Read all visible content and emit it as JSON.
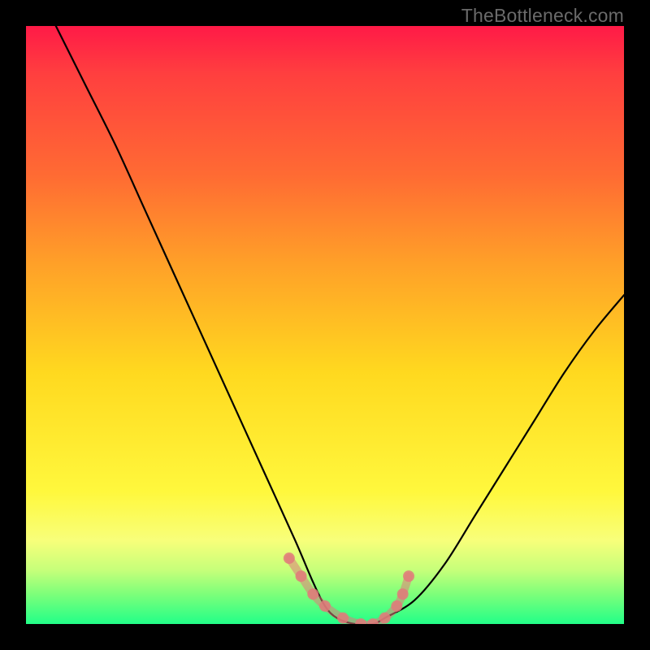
{
  "watermark": "TheBottleneck.com",
  "chart_data": {
    "type": "line",
    "title": "",
    "xlabel": "",
    "ylabel": "",
    "xlim": [
      0,
      100
    ],
    "ylim": [
      0,
      100
    ],
    "background_gradient_stops": [
      {
        "pos": 0,
        "color": "#ff1a47"
      },
      {
        "pos": 8,
        "color": "#ff3f3f"
      },
      {
        "pos": 25,
        "color": "#ff6b33"
      },
      {
        "pos": 40,
        "color": "#ffa128"
      },
      {
        "pos": 58,
        "color": "#ffd91f"
      },
      {
        "pos": 78,
        "color": "#fff83d"
      },
      {
        "pos": 86,
        "color": "#f8ff7a"
      },
      {
        "pos": 91,
        "color": "#c6ff7a"
      },
      {
        "pos": 95,
        "color": "#7dff7a"
      },
      {
        "pos": 100,
        "color": "#22ff88"
      }
    ],
    "series": [
      {
        "name": "bottleneck-curve",
        "x": [
          5,
          10,
          15,
          20,
          25,
          30,
          35,
          40,
          45,
          48,
          50,
          52,
          55,
          58,
          60,
          65,
          70,
          75,
          80,
          85,
          90,
          95,
          100
        ],
        "values": [
          100,
          90,
          80,
          69,
          58,
          47,
          36,
          25,
          14,
          7,
          3,
          1,
          0,
          0,
          1,
          4,
          10,
          18,
          26,
          34,
          42,
          49,
          55
        ]
      }
    ],
    "markers": {
      "name": "highlight-region",
      "color": "#e07a7a",
      "x": [
        44,
        46,
        48,
        50,
        53,
        56,
        58,
        60,
        62,
        63,
        64
      ],
      "values": [
        11,
        8,
        5,
        3,
        1,
        0,
        0,
        1,
        3,
        5,
        8
      ]
    }
  }
}
